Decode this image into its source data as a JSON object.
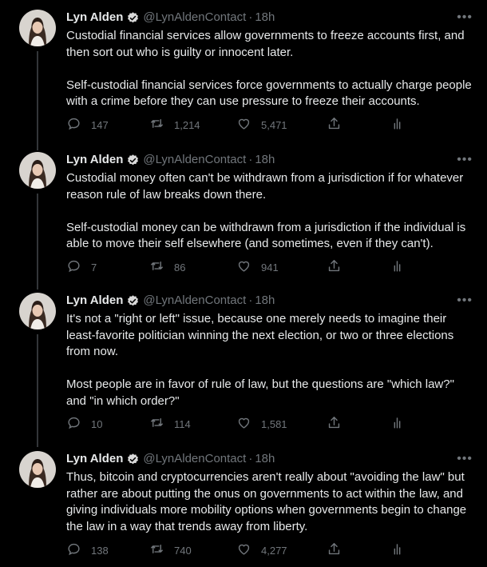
{
  "tweets": [
    {
      "author": "Lyn Alden",
      "handle": "@LynAldenContact",
      "time": "18h",
      "text": "Custodial financial services allow governments to freeze accounts first, and then sort out who is guilty or innocent later.\n\nSelf-custodial financial services force governments to actually charge people with a crime before they can use pressure to freeze their accounts.",
      "replies": "147",
      "retweets": "1,214",
      "likes": "5,471"
    },
    {
      "author": "Lyn Alden",
      "handle": "@LynAldenContact",
      "time": "18h",
      "text": "Custodial money often can't be withdrawn from a jurisdiction if for whatever reason rule of law breaks down there.\n\nSelf-custodial money can be withdrawn from a jurisdiction if the individual is able to move their self elsewhere (and sometimes, even if they can't).",
      "replies": "7",
      "retweets": "86",
      "likes": "941"
    },
    {
      "author": "Lyn Alden",
      "handle": "@LynAldenContact",
      "time": "18h",
      "text": "It's not a \"right or left\" issue, because one merely needs to imagine their least-favorite politician winning the next election, or two or three elections from now.\n\nMost people are in favor of rule of law, but the questions are \"which law?\" and \"in which order?\"",
      "replies": "10",
      "retweets": "114",
      "likes": "1,581"
    },
    {
      "author": "Lyn Alden",
      "handle": "@LynAldenContact",
      "time": "18h",
      "text": "Thus, bitcoin and cryptocurrencies aren't really about \"avoiding the law\" but rather are about putting the onus on governments to act within the law, and giving individuals more mobility options when governments begin to change the law in a way that trends away from liberty.",
      "replies": "138",
      "retweets": "740",
      "likes": "4,277"
    }
  ],
  "icons": {
    "verified": "verified-badge-icon",
    "reply": "reply-icon",
    "retweet": "retweet-icon",
    "like": "heart-icon",
    "share": "share-icon",
    "analytics": "analytics-icon",
    "more": "more-icon"
  },
  "colors": {
    "background": "#000000",
    "text": "#e7e9ea",
    "muted": "#71767b",
    "verified": "#d9d9d9"
  }
}
